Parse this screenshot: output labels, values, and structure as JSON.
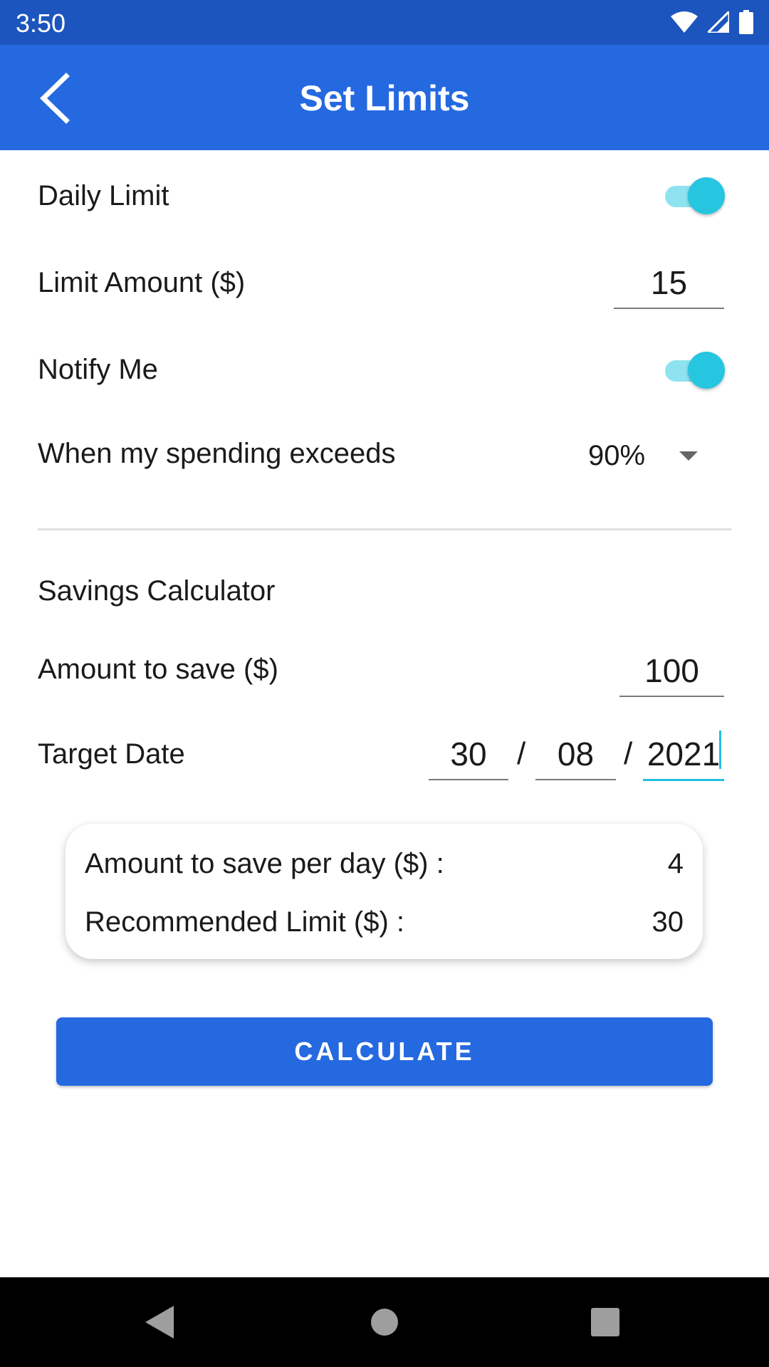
{
  "status_bar": {
    "time": "3:50"
  },
  "app_bar": {
    "title": "Set Limits"
  },
  "daily_limit": {
    "label": "Daily Limit",
    "enabled": true
  },
  "limit_amount": {
    "label": "Limit Amount ($)",
    "value": "15"
  },
  "notify_me": {
    "label": "Notify Me",
    "enabled": true
  },
  "threshold": {
    "label": "When my spending exceeds",
    "selected": "90%"
  },
  "savings": {
    "section_title": "Savings Calculator",
    "amount_label": "Amount to save ($)",
    "amount_value": "100",
    "target_date_label": "Target Date",
    "day": "30",
    "month": "08",
    "year": "2021",
    "separator": "/"
  },
  "results": {
    "per_day_label": "Amount to save per day ($) :",
    "per_day_value": "4",
    "recommended_label": "Recommended Limit ($) :",
    "recommended_value": "30"
  },
  "calculate_button": {
    "label": "CALCULATE"
  },
  "colors": {
    "status_bar": "#1c55bd",
    "primary": "#2569e0",
    "toggle_thumb": "#26c6e0",
    "toggle_track": "#8fe3f0",
    "focus_underline": "#22bfe0"
  },
  "icons": {
    "back": "chevron-left-icon",
    "wifi": "wifi-icon",
    "signal": "cell-signal-icon",
    "battery": "battery-icon",
    "nav_back": "triangle-back-icon",
    "nav_home": "circle-home-icon",
    "nav_recents": "square-recents-icon"
  }
}
